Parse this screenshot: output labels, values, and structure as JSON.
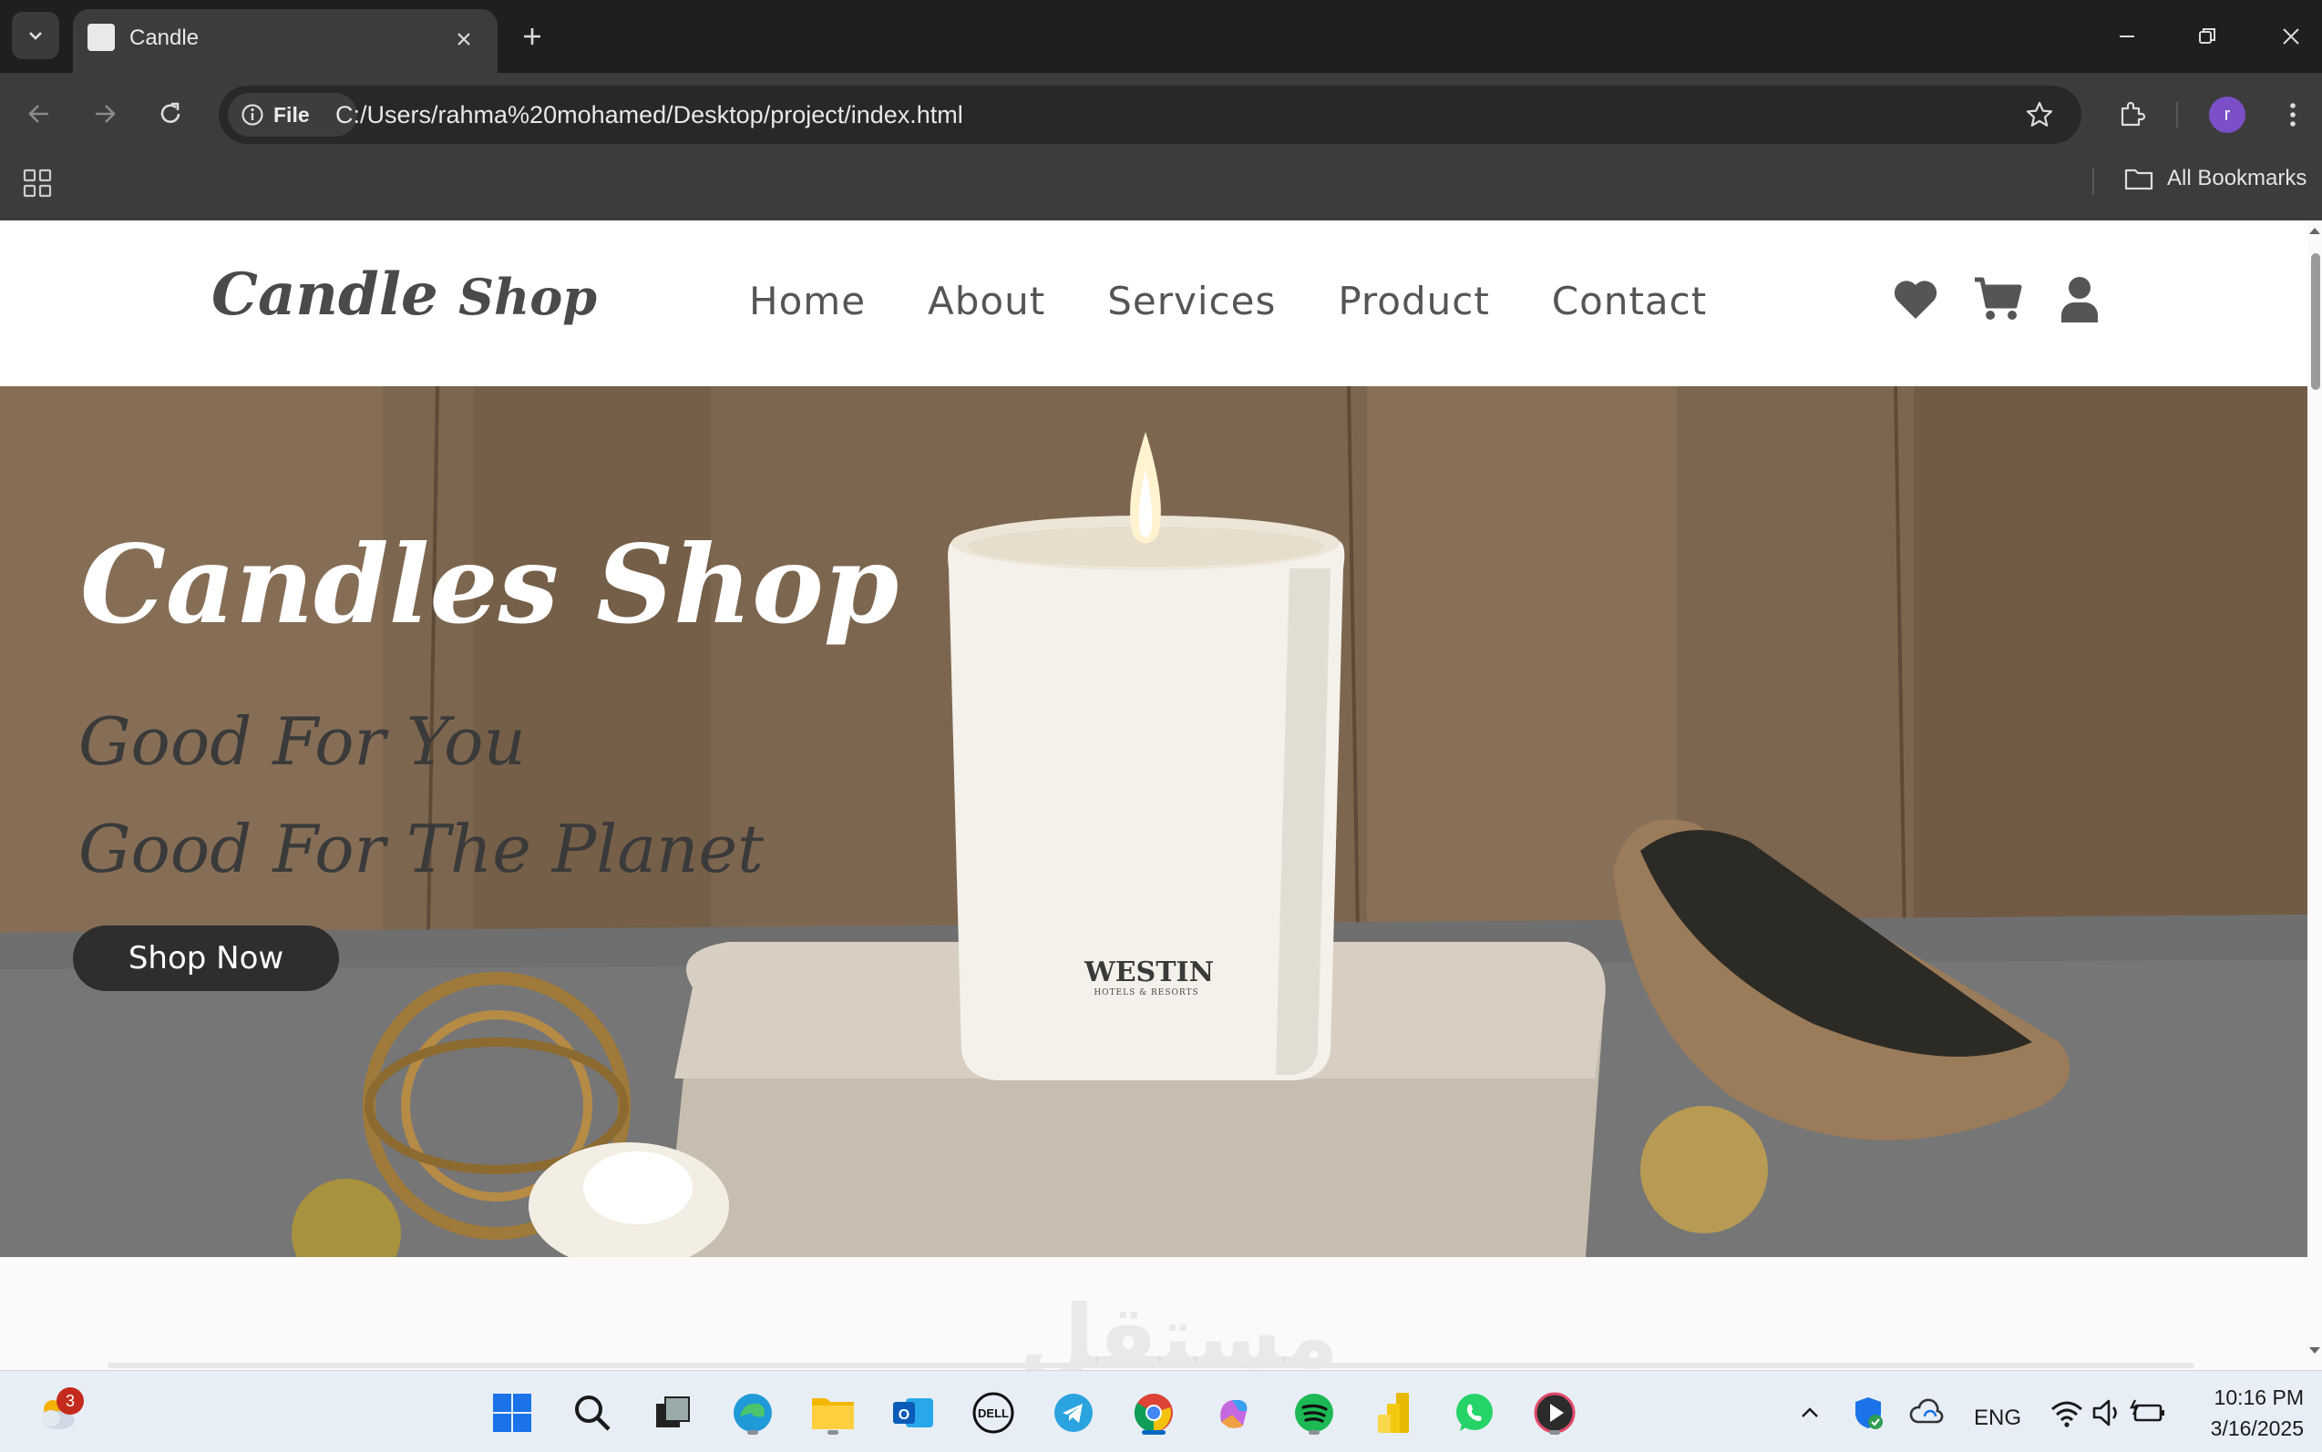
{
  "browser": {
    "tab_title": "Candle",
    "site_chip": "File",
    "url": "C:/Users/rahma%20mohamed/Desktop/project/index.html",
    "profile_initial": "r",
    "all_bookmarks": "All Bookmarks"
  },
  "site": {
    "logo_main": "Candle",
    "logo_sub": "Shop",
    "nav": [
      "Home",
      "About",
      "Services",
      "Product",
      "Contact"
    ],
    "header_icons": [
      "heart-icon",
      "cart-icon",
      "user-icon"
    ]
  },
  "hero": {
    "title": "Candles Shop",
    "line1": "Good For You",
    "line2": "Good For The Planet",
    "button": "Shop Now",
    "candle_brand": "WESTIN",
    "candle_brand_sub": "HOTELS & RESORTS"
  },
  "watermark": "مستقل",
  "taskbar": {
    "weather_badge": "3",
    "language": "ENG",
    "time": "10:16 PM",
    "date": "3/16/2025"
  },
  "colors": {
    "tab_bar": "#1f1f1f",
    "toolbar": "#3c3c3c",
    "button_dark": "#2e2e2e",
    "hero_title": "#ffffff",
    "hero_sub": "#3a3a3a"
  }
}
